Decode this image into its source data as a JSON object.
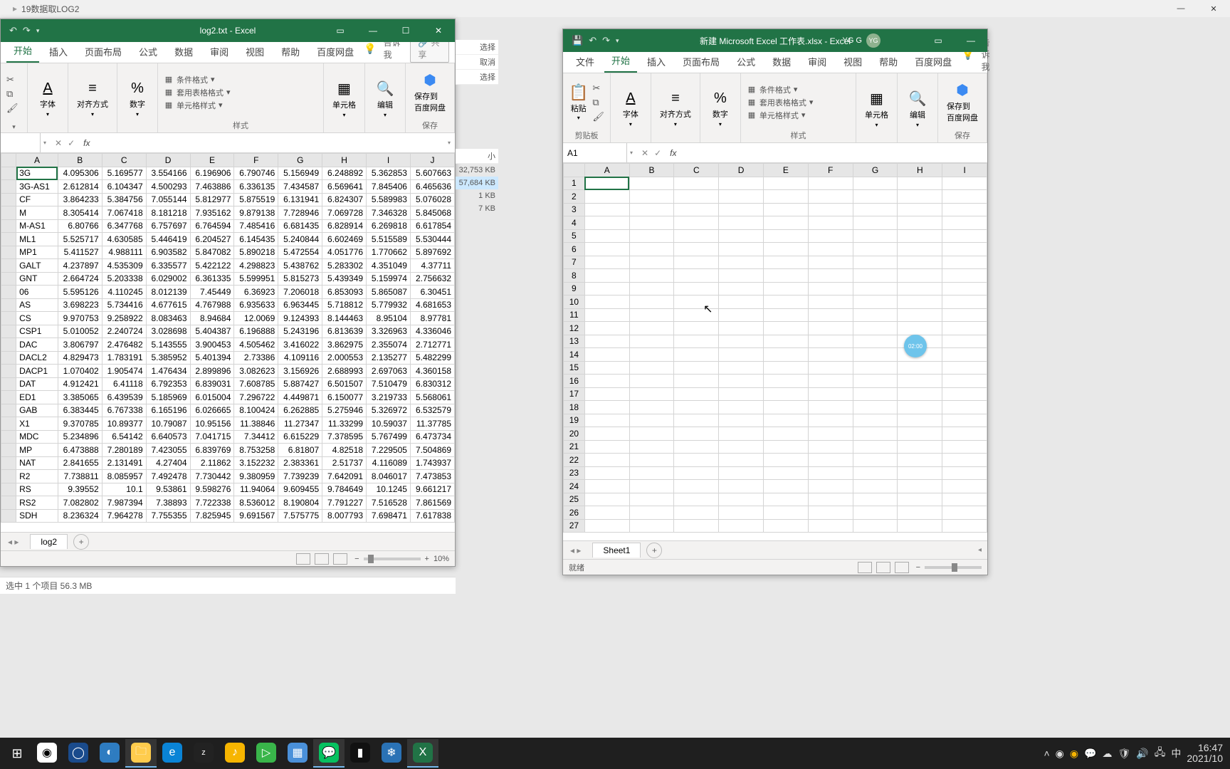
{
  "os_title": "19数据取LOG2",
  "left": {
    "title": "log2.txt - Excel",
    "tabs": [
      "开始",
      "插入",
      "页面布局",
      "公式",
      "数据",
      "审阅",
      "视图",
      "帮助",
      "百度网盘"
    ],
    "tellme": "告诉我",
    "share": "共享",
    "groups": {
      "font": "字体",
      "align": "对齐方式",
      "number": "数字",
      "styles": "样式",
      "cells": "单元格",
      "edit": "编辑",
      "save": "保存",
      "save_btn": "保存到\n百度网盘",
      "cond": "条件格式",
      "tablefmt": "套用表格格式",
      "cellstyle": "单元格样式"
    },
    "name_box": "",
    "sheet_tab": "log2",
    "zoom": "10%",
    "col_headers": [
      "A",
      "B",
      "C",
      "D",
      "E",
      "F",
      "G",
      "H",
      "I",
      "J"
    ],
    "rows": [
      [
        "3G",
        "4.095306",
        "5.169577",
        "3.554166",
        "6.196906",
        "6.790746",
        "5.156949",
        "6.248892",
        "5.362853",
        "5.607663"
      ],
      [
        "3G-AS1",
        "2.612814",
        "6.104347",
        "4.500293",
        "7.463886",
        "6.336135",
        "7.434587",
        "6.569641",
        "7.845406",
        "6.465636"
      ],
      [
        "CF",
        "3.864233",
        "5.384756",
        "7.055144",
        "5.812977",
        "5.875519",
        "6.131941",
        "6.824307",
        "5.589983",
        "5.076028"
      ],
      [
        "M",
        "8.305414",
        "7.067418",
        "8.181218",
        "7.935162",
        "9.879138",
        "7.728946",
        "7.069728",
        "7.346328",
        "5.845068"
      ],
      [
        "M-AS1",
        "6.80766",
        "6.347768",
        "6.757697",
        "6.764594",
        "7.485416",
        "6.681435",
        "6.828914",
        "6.269818",
        "6.617854"
      ],
      [
        "ML1",
        "5.525717",
        "4.630585",
        "5.446419",
        "6.204527",
        "6.145435",
        "5.240844",
        "6.602469",
        "5.515589",
        "5.530444"
      ],
      [
        "MP1",
        "5.411527",
        "4.988111",
        "6.903582",
        "5.847082",
        "5.890218",
        "5.472554",
        "4.051776",
        "1.770662",
        "5.897692"
      ],
      [
        "GALT",
        "4.237897",
        "4.535309",
        "6.335577",
        "5.422122",
        "4.298823",
        "5.438762",
        "5.283302",
        "4.351049",
        "4.37711"
      ],
      [
        "GNT",
        "2.664724",
        "5.203338",
        "6.029002",
        "6.361335",
        "5.599951",
        "5.815273",
        "5.439349",
        "5.159974",
        "2.756632"
      ],
      [
        "06",
        "5.595126",
        "4.110245",
        "8.012139",
        "7.45449",
        "6.36923",
        "7.206018",
        "6.853093",
        "5.865087",
        "6.30451"
      ],
      [
        "AS",
        "3.698223",
        "5.734416",
        "4.677615",
        "4.767988",
        "6.935633",
        "6.963445",
        "5.718812",
        "5.779932",
        "4.681653"
      ],
      [
        "CS",
        "9.970753",
        "9.258922",
        "8.083463",
        "8.94684",
        "12.0069",
        "9.124393",
        "8.144463",
        "8.95104",
        "8.97781"
      ],
      [
        "CSP1",
        "5.010052",
        "2.240724",
        "3.028698",
        "5.404387",
        "6.196888",
        "5.243196",
        "6.813639",
        "3.326963",
        "4.336046"
      ],
      [
        "DAC",
        "3.806797",
        "2.476482",
        "5.143555",
        "3.900453",
        "4.505462",
        "3.416022",
        "3.862975",
        "2.355074",
        "2.712771"
      ],
      [
        "DACL2",
        "4.829473",
        "1.783191",
        "5.385952",
        "5.401394",
        "2.73386",
        "4.109116",
        "2.000553",
        "2.135277",
        "5.482299"
      ],
      [
        "DACP1",
        "1.070402",
        "1.905474",
        "1.476434",
        "2.899896",
        "3.082623",
        "3.156926",
        "2.688993",
        "2.697063",
        "4.360158"
      ],
      [
        "DAT",
        "4.912421",
        "6.41118",
        "6.792353",
        "6.839031",
        "7.608785",
        "5.887427",
        "6.501507",
        "7.510479",
        "6.830312"
      ],
      [
        "ED1",
        "3.385065",
        "6.439539",
        "5.185969",
        "6.015004",
        "7.296722",
        "4.449871",
        "6.150077",
        "3.219733",
        "5.568061"
      ],
      [
        "GAB",
        "6.383445",
        "6.767338",
        "6.165196",
        "6.026665",
        "8.100424",
        "6.262885",
        "5.275946",
        "5.326972",
        "6.532579"
      ],
      [
        "X1",
        "9.370785",
        "10.89377",
        "10.79087",
        "10.95156",
        "11.38846",
        "11.27347",
        "11.33299",
        "10.59037",
        "11.37785"
      ],
      [
        "MDC",
        "5.234896",
        "6.54142",
        "6.640573",
        "7.041715",
        "7.34412",
        "6.615229",
        "7.378595",
        "5.767499",
        "6.473734"
      ],
      [
        "MP",
        "6.473888",
        "7.280189",
        "7.423055",
        "6.839769",
        "8.753258",
        "6.81807",
        "4.82518",
        "7.229505",
        "7.504869"
      ],
      [
        "NAT",
        "2.841655",
        "2.131491",
        "4.27404",
        "2.11862",
        "3.152232",
        "2.383361",
        "2.51737",
        "4.116089",
        "1.743937"
      ],
      [
        "R2",
        "7.738811",
        "8.085957",
        "7.492478",
        "7.730442",
        "9.380959",
        "7.739239",
        "7.642091",
        "8.046017",
        "7.473853"
      ],
      [
        "RS",
        "9.39552",
        "10.1",
        "9.53861",
        "9.598276",
        "11.94064",
        "9.609455",
        "9.784649",
        "10.1245",
        "9.661217"
      ],
      [
        "RS2",
        "7.082802",
        "7.987394",
        "7.38893",
        "7.722338",
        "8.536012",
        "8.190804",
        "7.791227",
        "7.516528",
        "7.861569"
      ],
      [
        "SDH",
        "8.236324",
        "7.964278",
        "7.755355",
        "7.825945",
        "9.691567",
        "7.575775",
        "8.007793",
        "7.698471",
        "7.617838"
      ]
    ]
  },
  "explorer": {
    "menu_items": [
      "选择",
      "取消",
      "选择"
    ],
    "col_size": "小",
    "files": [
      {
        "size": "32,753 KB"
      },
      {
        "size": "57,684 KB",
        "sel": true
      },
      {
        "size": "1 KB"
      },
      {
        "size": "7 KB"
      }
    ],
    "status": "选中 1 个项目  56.3 MB"
  },
  "right": {
    "title": "新建 Microsoft Excel 工作表.xlsx - Excel",
    "account": "YG G",
    "avatar": "YG",
    "tabs": [
      "文件",
      "开始",
      "插入",
      "页面布局",
      "公式",
      "数据",
      "审阅",
      "视图",
      "帮助",
      "百度网盘"
    ],
    "tellme": "告诉我",
    "groups": {
      "clipboard": "剪贴板",
      "paste": "粘贴",
      "font": "字体",
      "align": "对齐方式",
      "number": "数字",
      "styles": "样式",
      "cells": "单元格",
      "edit": "编辑",
      "save": "保存",
      "save_btn": "保存到\n百度网盘",
      "cond": "条件格式",
      "tablefmt": "套用表格格式",
      "cellstyle": "单元格样式"
    },
    "name_box": "A1",
    "sheet_tab": "Sheet1",
    "status": "就绪",
    "col_headers": [
      "A",
      "B",
      "C",
      "D",
      "E",
      "F",
      "G",
      "H",
      "I"
    ],
    "row_count": 27
  },
  "bubble": "02:00",
  "taskbar": {
    "clock_time": "16:47",
    "clock_date": "2021/10",
    "ime": "中"
  }
}
